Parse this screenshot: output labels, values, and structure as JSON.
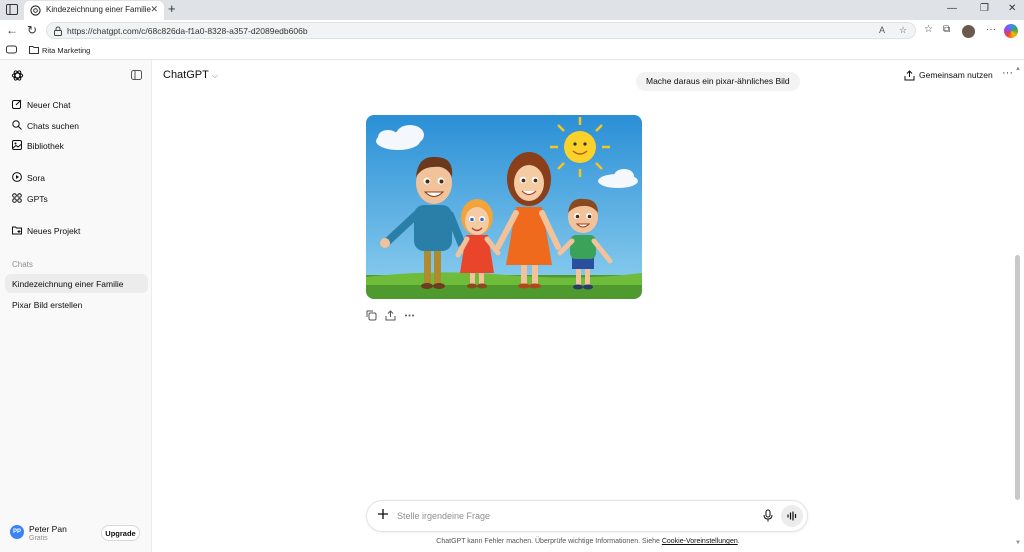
{
  "browser": {
    "tab_title": "Kindezeichnung einer Familie",
    "url": "https://chatgpt.com/c/68c826da-f1a0-8328-a357-d2089edb606b",
    "bookmark_folder": "Rita Marketing"
  },
  "sidebar": {
    "nav": [
      {
        "label": "Neuer Chat",
        "icon": "edit-icon"
      },
      {
        "label": "Chats suchen",
        "icon": "search-icon"
      },
      {
        "label": "Bibliothek",
        "icon": "library-icon"
      },
      {
        "label": "Sora",
        "icon": "play-icon"
      },
      {
        "label": "GPTs",
        "icon": "grid-icon"
      },
      {
        "label": "Neues Projekt",
        "icon": "folder-plus-icon"
      }
    ],
    "section_label": "Chats",
    "chats": [
      {
        "label": "Kindezeichnung einer Familie",
        "active": true
      },
      {
        "label": "Pixar Bild erstellen",
        "active": false
      }
    ],
    "user": {
      "initials": "PP",
      "name": "Peter Pan",
      "plan": "Gratis",
      "upgrade_label": "Upgrade"
    }
  },
  "header": {
    "model": "ChatGPT",
    "share_label": "Gemeinsam nutzen"
  },
  "conversation": {
    "user_message": "Mache daraus ein pixar-ähnliches Bild"
  },
  "composer": {
    "placeholder": "Stelle irgendeine Frage"
  },
  "footer": {
    "disclaimer": "ChatGPT kann Fehler machen. Überprüfe wichtige Informationen. Siehe ",
    "link": "Cookie-Voreinstellungen",
    "end": "."
  },
  "colors": {
    "accent_avatar": "#3b82f6",
    "sidebar_bg": "#f9f9f9",
    "active_chat_bg": "#ececec"
  }
}
